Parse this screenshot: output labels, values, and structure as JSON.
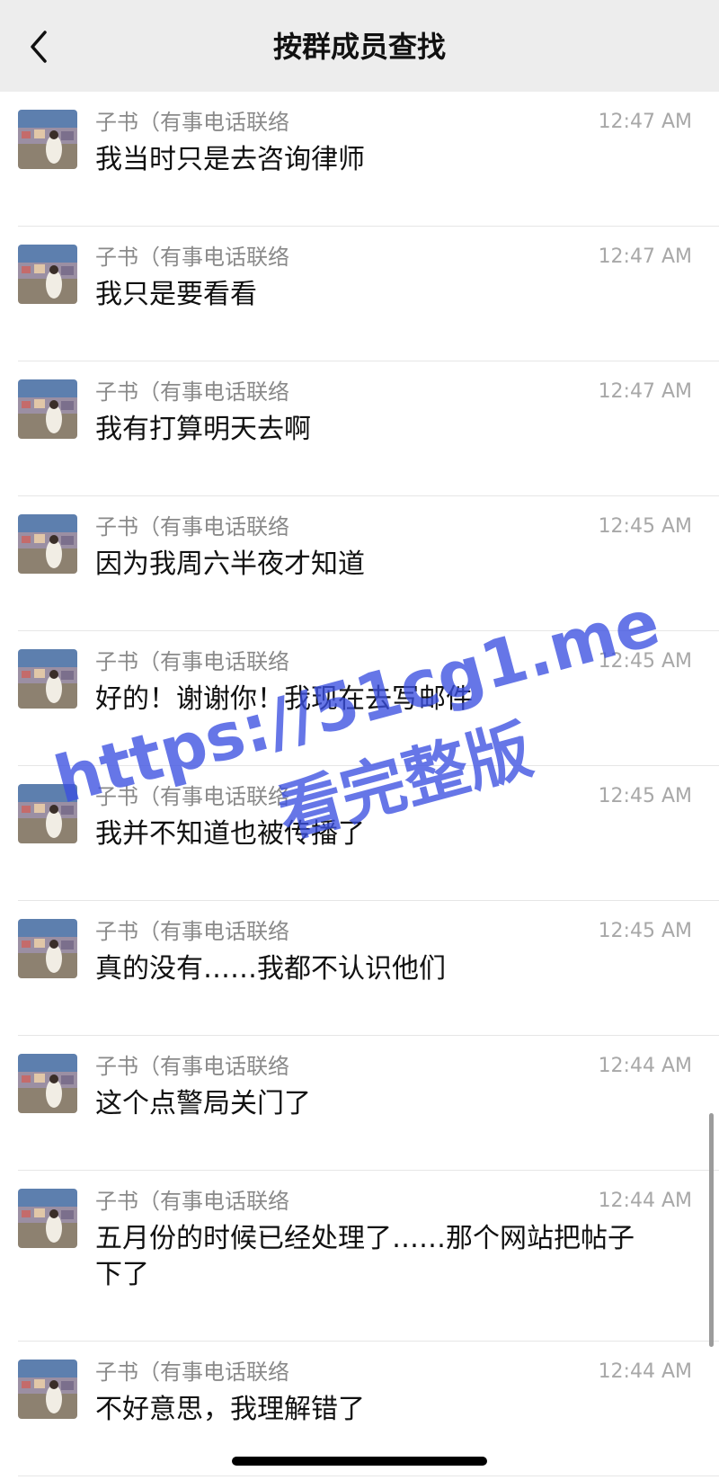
{
  "header": {
    "title": "按群成员查找",
    "back_icon": "chevron-left-icon"
  },
  "watermark": {
    "line1": "https://51cg1.me",
    "line2": "看完整版",
    "color": "#3b4fe0"
  },
  "messages": [
    {
      "sender": "子书（有事电话联络",
      "time": "12:47 AM",
      "text": "我当时只是去咨询律师"
    },
    {
      "sender": "子书（有事电话联络",
      "time": "12:47 AM",
      "text": "我只是要看看"
    },
    {
      "sender": "子书（有事电话联络",
      "time": "12:47 AM",
      "text": "我有打算明天去啊"
    },
    {
      "sender": "子书（有事电话联络",
      "time": "12:45 AM",
      "text": "因为我周六半夜才知道"
    },
    {
      "sender": "子书（有事电话联络",
      "time": "12:45 AM",
      "text": "好的！谢谢你！我现在去写邮件"
    },
    {
      "sender": "子书（有事电话联络",
      "time": "12:45 AM",
      "text": "我并不知道也被传播了"
    },
    {
      "sender": "子书（有事电话联络",
      "time": "12:45 AM",
      "text": "真的没有……我都不认识他们"
    },
    {
      "sender": "子书（有事电话联络",
      "time": "12:44 AM",
      "text": "这个点警局关门了"
    },
    {
      "sender": "子书（有事电话联络",
      "time": "12:44 AM",
      "text": "五月份的时候已经处理了……那个网站把帖子下了"
    },
    {
      "sender": "子书（有事电话联络",
      "time": "12:44 AM",
      "text": "不好意思，我理解错了"
    }
  ]
}
